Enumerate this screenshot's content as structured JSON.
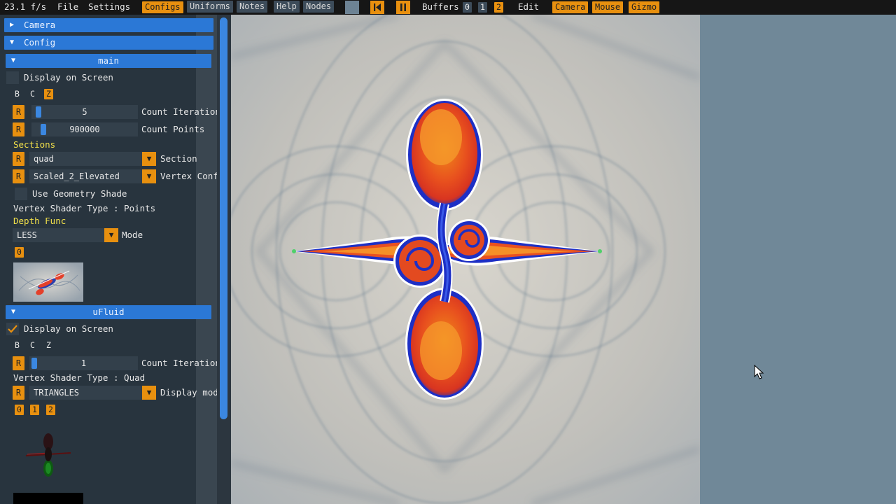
{
  "menubar": {
    "fps": "23.1 f/s",
    "file": "File",
    "settings": "Settings",
    "configs": "Configs",
    "uniforms": "Uniforms",
    "notes": "Notes",
    "help": "Help",
    "nodes": "Nodes",
    "buffers_label": "Buffers",
    "buffers": [
      "0",
      "1",
      "2"
    ],
    "edit": "Edit",
    "camera": "Camera",
    "mouse": "Mouse",
    "gizmo": "Gizmo"
  },
  "sidebar": {
    "camera_header": "Camera",
    "config_header": "Config",
    "main": {
      "header": "main",
      "display_on_screen": "Display on Screen",
      "bcz": [
        "B",
        "C",
        "Z"
      ],
      "count_iteration": {
        "r": "R",
        "value": "5",
        "label": "Count Iteration"
      },
      "count_points": {
        "r": "R",
        "value": "900000",
        "label": "Count Points"
      },
      "sections_title": "Sections",
      "section": {
        "r": "R",
        "value": "quad",
        "label": "Section"
      },
      "vertex_conf": {
        "r": "R",
        "value": "Scaled_2_Elevated",
        "label": "Vertex Conf"
      },
      "use_geometry": "Use Geometry Shade",
      "vertex_shader_type": "Vertex Shader Type : Points",
      "depth_func_title": "Depth Func",
      "mode": {
        "value": "LESS",
        "label": "Mode"
      },
      "buffer_index": "0"
    },
    "ufluid": {
      "header": "uFluid",
      "display_on_screen": "Display on Screen",
      "bcz": [
        "B",
        "C",
        "Z"
      ],
      "count_iteration": {
        "r": "R",
        "value": "1",
        "label": "Count Iteration"
      },
      "vertex_shader_type": "Vertex Shader Type : Quad",
      "display_mode": {
        "r": "R",
        "value": "TRIANGLES",
        "label": "Display mod"
      },
      "buffer_indices": [
        "0",
        "1",
        "2"
      ]
    }
  },
  "colors": {
    "accent_orange": "#e8900f",
    "header_blue": "#2b78d6",
    "panel_bg": "#28343e",
    "clear_color": "#708898",
    "yellow_title": "#f2e04a"
  },
  "icons": {
    "rewind": "skip-back-icon",
    "pause": "pause-icon",
    "collapse": "triangle-down-icon",
    "expand": "triangle-right-icon",
    "check": "check-icon",
    "cursor": "mouse-cursor-icon"
  }
}
